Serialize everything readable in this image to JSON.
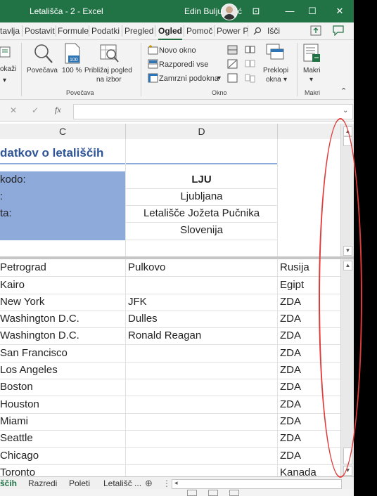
{
  "window": {
    "title": "Letališča  -  2  -  Excel",
    "user": "Edin Buljubašić",
    "buttons": {
      "ribbon_opts": "⊡",
      "minimize": "—",
      "maximize": "☐",
      "close": "✕"
    }
  },
  "tabs": [
    {
      "label": "tavlja"
    },
    {
      "label": "Postavit"
    },
    {
      "label": "Formule"
    },
    {
      "label": "Podatki"
    },
    {
      "label": "Pregled"
    },
    {
      "label": "Ogled"
    },
    {
      "label": "Pomoč"
    },
    {
      "label": "Power P"
    },
    {
      "label": "Išči"
    }
  ],
  "ribbon": {
    "views_partial": "okaži",
    "zoom": "Povečava",
    "zoom100": "100 %",
    "zoom_sel_1": "Približaj pogled",
    "zoom_sel_2": "na izbor",
    "group_zoom": "Povečava",
    "new_window": "Novo okno",
    "arrange": "Razporedi vse",
    "freeze": "Zamrzni podokna",
    "switch_1": "Preklopi",
    "switch_2": "okna",
    "group_window": "Okno",
    "macros": "Makri",
    "group_macros": "Makri"
  },
  "formula_bar": {
    "cancel": "✕",
    "enter": "✓",
    "fx": "fx",
    "value": ""
  },
  "columns": [
    "C",
    "D"
  ],
  "top_pane": {
    "title": "datkov o letališčih",
    "rows": [
      {
        "label": "kodo:",
        "value": "LJU"
      },
      {
        "label": ":",
        "value": "Ljubljana"
      },
      {
        "label": "ta:",
        "value": "Letališče Jožeta Pučnika"
      },
      {
        "label": "",
        "value": "Slovenija"
      }
    ]
  },
  "bottom_rows": [
    {
      "city": "Petrograd",
      "airport": "Pulkovo",
      "country": "Rusija"
    },
    {
      "city": "Kairo",
      "airport": "",
      "country": "Egipt"
    },
    {
      "city": "New York",
      "airport": "JFK",
      "country": "ZDA"
    },
    {
      "city": "Washington D.C.",
      "airport": "Dulles",
      "country": "ZDA"
    },
    {
      "city": "Washington D.C.",
      "airport": "Ronald Reagan",
      "country": "ZDA"
    },
    {
      "city": "San Francisco",
      "airport": "",
      "country": "ZDA"
    },
    {
      "city": "Los Angeles",
      "airport": "",
      "country": "ZDA"
    },
    {
      "city": "Boston",
      "airport": "",
      "country": "ZDA"
    },
    {
      "city": "Houston",
      "airport": "",
      "country": "ZDA"
    },
    {
      "city": "Miami",
      "airport": "",
      "country": "ZDA"
    },
    {
      "city": "Seattle",
      "airport": "",
      "country": "ZDA"
    },
    {
      "city": "Chicago",
      "airport": "",
      "country": "ZDA"
    },
    {
      "city": "Toronto",
      "airport": "",
      "country": "Kanada"
    }
  ],
  "sheet_tabs": [
    {
      "label": "ščih"
    },
    {
      "label": "Razredi"
    },
    {
      "label": "Poleti"
    },
    {
      "label": "Letališč ..."
    }
  ],
  "sheet_controls": {
    "add": "⊕",
    "more": "⋮",
    "scroll_left": "◂"
  },
  "colors": {
    "excel_green": "#217346",
    "highlight_blue": "#8eaadb",
    "title_blue": "#2f5597",
    "annotation_red": "#e03a3a"
  }
}
